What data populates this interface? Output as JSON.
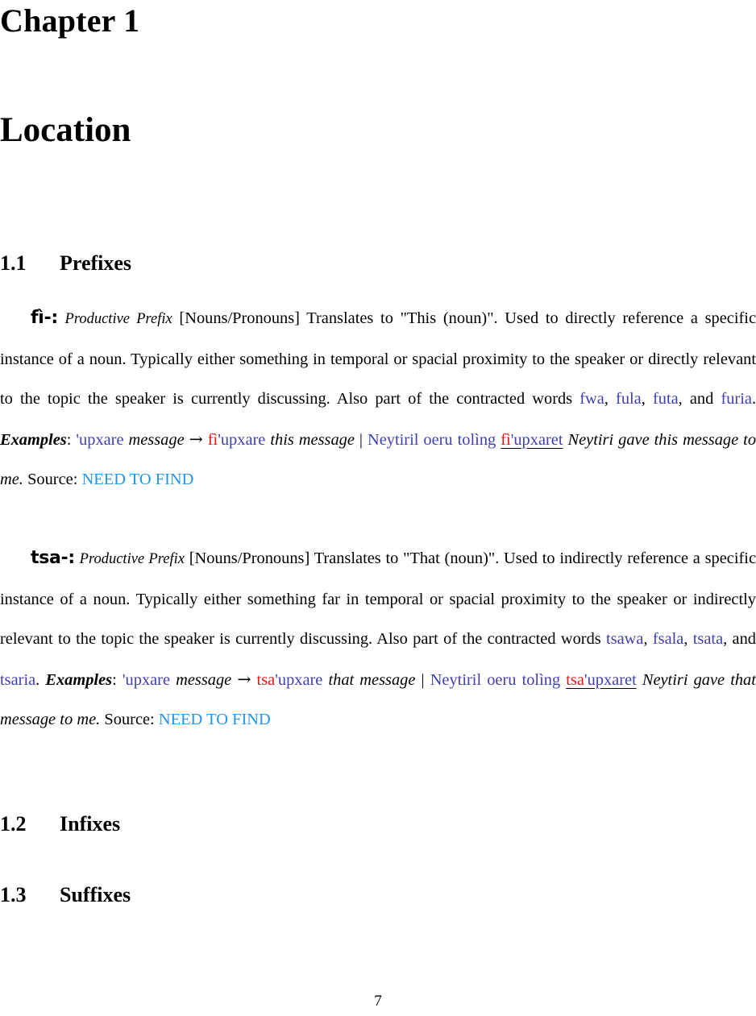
{
  "chapter": {
    "number_label": "Chapter 1",
    "title": "Location"
  },
  "sections": [
    {
      "number": "1.1",
      "title": "Prefixes"
    },
    {
      "number": "1.2",
      "title": "Infixes"
    },
    {
      "number": "1.3",
      "title": "Suffixes"
    }
  ],
  "entries": [
    {
      "headword": "fì-:",
      "part_of_speech": "Productive Prefix",
      "categories": "[Nouns/Pronouns]",
      "definition_intro": "Translates to \"This (noun)\". Used to directly reference a specific instance of a noun. Typically either something in temporal or spacial proximity to the speaker or directly relevant to the topic the speaker is currently discussing. Also part of the contracted words",
      "contracted_words": [
        "fwa",
        "fula",
        "futa",
        "furia"
      ],
      "examples_label": "Examples",
      "example_1": {
        "base": "'upxare",
        "base_gloss": "message",
        "arrow": "→",
        "derived_prefix": "fì",
        "derived_stem": "'upxare",
        "derived_gloss": "this message"
      },
      "example_2": {
        "sentence_before": "Neytiril oeru tolìng",
        "target_prefix": "fì",
        "target_stem": "'upxaret",
        "translation": "Neytiri gave this message to me."
      },
      "source_label": "Source:",
      "source_value": "NEED TO FIND"
    },
    {
      "headword": "tsa-:",
      "part_of_speech": "Productive Prefix",
      "categories": "[Nouns/Pronouns]",
      "definition_intro": "Translates to \"That (noun)\". Used to indirectly reference a specific instance of a noun. Typically either something far in temporal or spacial proximity to the speaker or indirectly relevant to the topic the speaker is currently discussing. Also part of the contracted words",
      "contracted_words": [
        "tsawa",
        "fsala",
        "tsata",
        "tsaria"
      ],
      "examples_label": "Examples",
      "example_1": {
        "base": "'upxare",
        "base_gloss": "message",
        "arrow": "→",
        "derived_prefix": "tsa",
        "derived_stem": "'upxare",
        "derived_gloss": "that message"
      },
      "example_2": {
        "sentence_before": "Neytiril oeru tolìng",
        "target_prefix": "tsa",
        "target_stem": "'upxaret",
        "translation": "Neytiri gave that message to me."
      },
      "source_label": "Source:",
      "source_value": "NEED TO FIND"
    }
  ],
  "page_number": "7",
  "colors": {
    "link": "#4040b0",
    "morpheme_highlight": "#e01515",
    "source_link": "#2196e8",
    "text": "#000000",
    "background": "#ffffff"
  },
  "punctuation": {
    "comma": ", ",
    "and": "and ",
    "period": ".",
    "colon": ":",
    "pipe": "|",
    "open_quote": "\"",
    "close_quote": "\""
  }
}
